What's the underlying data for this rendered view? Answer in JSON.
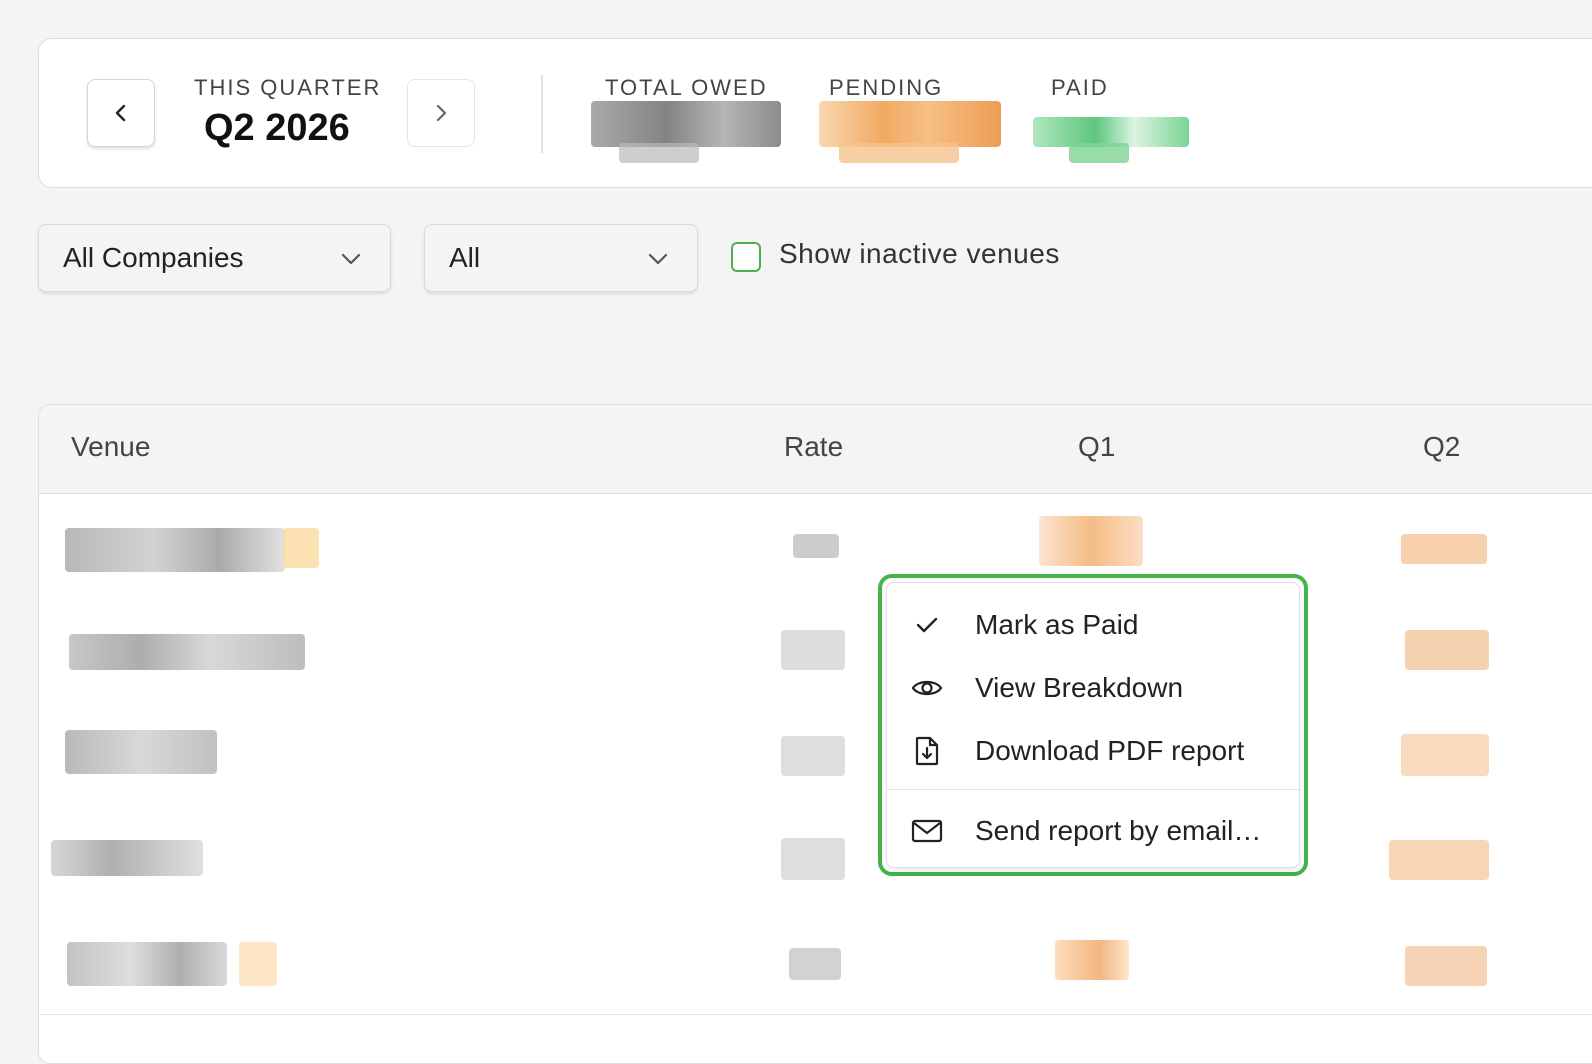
{
  "header": {
    "period_label": "THIS QUARTER",
    "period_value": "Q2 2026",
    "stats": [
      {
        "label": "TOTAL OWED",
        "color": "#7a7a7a"
      },
      {
        "label": "PENDING",
        "color": "#f0a050"
      },
      {
        "label": "PAID",
        "color": "#4cc070"
      }
    ]
  },
  "filters": {
    "company_select": "All Companies",
    "status_select": "All",
    "show_inactive_label": "Show inactive venues",
    "show_inactive_checked": false
  },
  "table": {
    "columns": [
      "Venue",
      "Rate",
      "Q1",
      "Q2"
    ]
  },
  "context_menu": {
    "items": [
      {
        "label": "Mark as Paid",
        "icon": "check-icon"
      },
      {
        "label": "View Breakdown",
        "icon": "eye-icon"
      },
      {
        "label": "Download PDF report",
        "icon": "file-download-icon"
      },
      {
        "label": "Send report by email…",
        "icon": "mail-icon"
      }
    ]
  }
}
